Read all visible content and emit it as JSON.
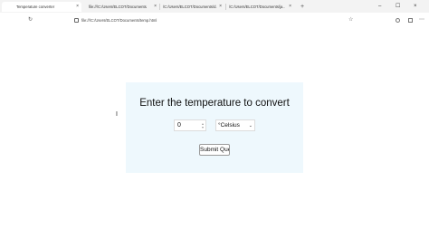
{
  "browser": {
    "tabs": [
      {
        "label": "Temperature converter",
        "active": true
      },
      {
        "label": "file:///C:/Users/ELCOT/Documents/",
        "active": false
      },
      {
        "label": "/C:/Users/ELCOT/Documents/d...",
        "active": false
      },
      {
        "label": "/C:/Users/ELCOT/Documents/ja...",
        "active": false
      }
    ],
    "tab_close_glyph": "×",
    "new_tab_glyph": "+",
    "window_controls": {
      "minimize": "–",
      "maximize": "☐",
      "close": "×"
    },
    "toolbar": {
      "reload_glyph": "↻",
      "address": "file:///C:/Users/ELCOT/Documents/temp.html",
      "favorite_glyph": "☆"
    }
  },
  "page": {
    "heading": "Enter the temperature to convert",
    "temperature_value": "0",
    "unit_selected": "°Celsius",
    "submit_label": "Submit Query"
  },
  "colors": {
    "form_background": "#eef8fd",
    "tabbar_background": "#f3f3f3"
  }
}
